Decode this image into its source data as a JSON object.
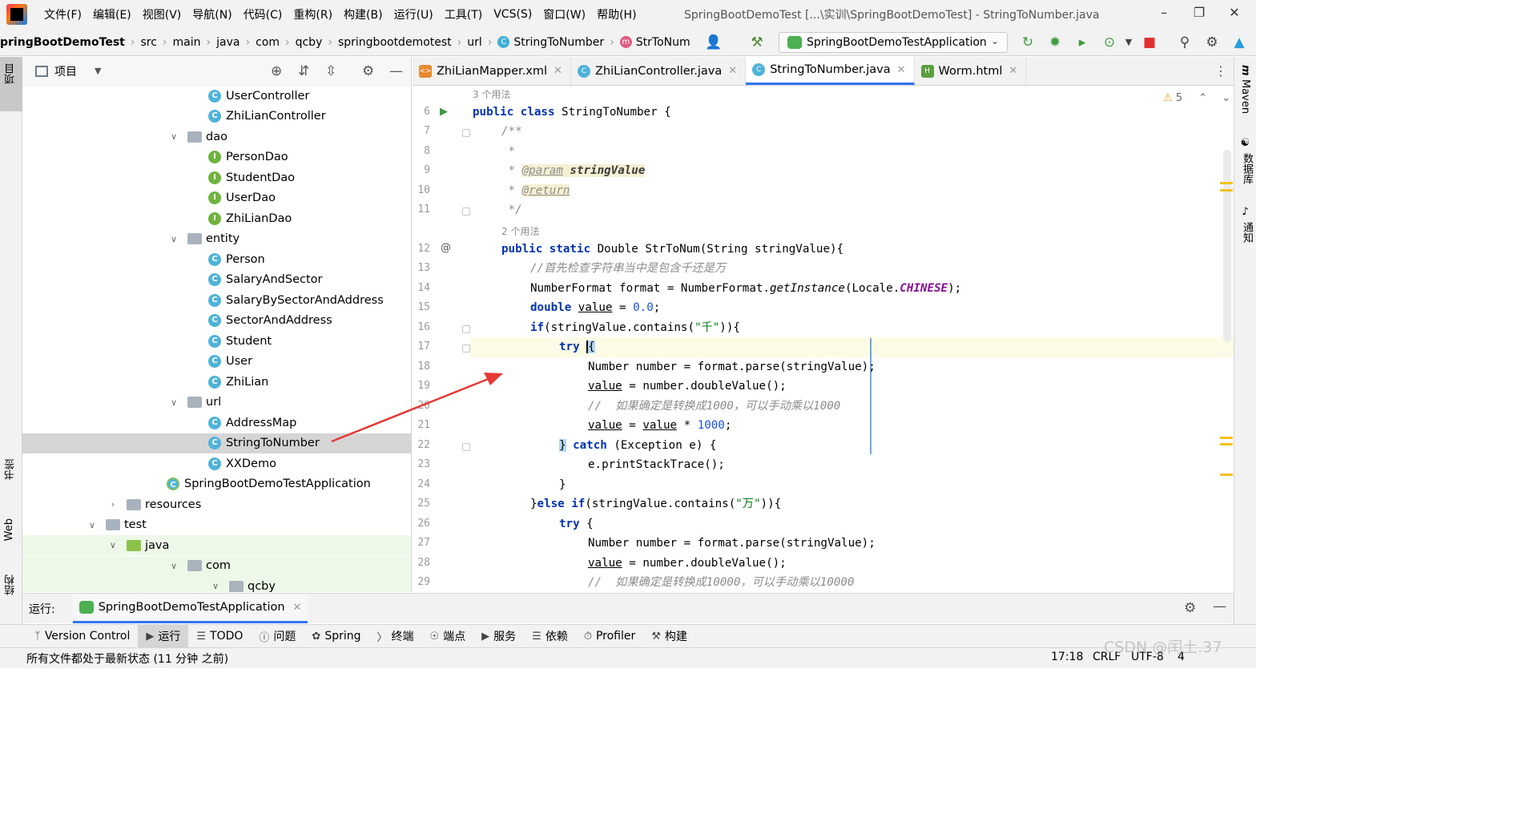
{
  "menu": [
    "文件(F)",
    "编辑(E)",
    "视图(V)",
    "导航(N)",
    "代码(C)",
    "重构(R)",
    "构建(B)",
    "运行(U)",
    "工具(T)",
    "VCS(S)",
    "窗口(W)",
    "帮助(H)"
  ],
  "window_title": "SpringBootDemoTest [...\\实训\\SpringBootDemoTest] - StringToNumber.java",
  "breadcrumbs": [
    "pringBootDemoTest",
    "src",
    "main",
    "java",
    "com",
    "qcby",
    "springbootdemotest",
    "url",
    "StringToNumber",
    "StrToNum"
  ],
  "run_config": "SpringBootDemoTestApplication",
  "left_strip": {
    "project": "项目",
    "bookmarks": "书签",
    "web": "Web",
    "structure": "结构"
  },
  "right_strip": {
    "maven": "Maven",
    "database": "数据库",
    "notifications": "通知"
  },
  "project_panel": {
    "title": "项目",
    "tree": [
      {
        "label": "UserController",
        "kind": "class",
        "level": 3
      },
      {
        "label": "ZhiLianController",
        "kind": "class",
        "level": 3
      },
      {
        "label": "dao",
        "kind": "folder",
        "level": 2,
        "expanded": true
      },
      {
        "label": "PersonDao",
        "kind": "interface",
        "level": 3
      },
      {
        "label": "StudentDao",
        "kind": "interface",
        "level": 3
      },
      {
        "label": "UserDao",
        "kind": "interface",
        "level": 3
      },
      {
        "label": "ZhiLianDao",
        "kind": "interface",
        "level": 3
      },
      {
        "label": "entity",
        "kind": "folder",
        "level": 2,
        "expanded": true
      },
      {
        "label": "Person",
        "kind": "class",
        "level": 3
      },
      {
        "label": "SalaryAndSector",
        "kind": "class",
        "level": 3
      },
      {
        "label": "SalaryBySectorAndAddress",
        "kind": "class",
        "level": 3
      },
      {
        "label": "SectorAndAddress",
        "kind": "class",
        "level": 3
      },
      {
        "label": "Student",
        "kind": "class",
        "level": 3
      },
      {
        "label": "User",
        "kind": "class",
        "level": 3
      },
      {
        "label": "ZhiLian",
        "kind": "class",
        "level": 3
      },
      {
        "label": "url",
        "kind": "folder",
        "level": 2,
        "expanded": true
      },
      {
        "label": "AddressMap",
        "kind": "class",
        "level": 3
      },
      {
        "label": "StringToNumber",
        "kind": "runclass",
        "level": 3,
        "selected": true
      },
      {
        "label": "XXDemo",
        "kind": "runclass",
        "level": 3
      },
      {
        "label": "SpringBootDemoTestApplication",
        "kind": "spring",
        "level": 2
      },
      {
        "label": "resources",
        "kind": "folder",
        "level": 1,
        "expanded": false
      },
      {
        "label": "test",
        "kind": "folder",
        "level": 0,
        "expanded": true
      },
      {
        "label": "java",
        "kind": "greenfolder",
        "level": 1,
        "expanded": true,
        "test": true
      },
      {
        "label": "com",
        "kind": "folder",
        "level": 2,
        "expanded": true,
        "test": true
      },
      {
        "label": "qcby",
        "kind": "folder",
        "level": 3,
        "expanded": true,
        "test": true
      }
    ]
  },
  "editor_tabs": [
    {
      "label": "ZhiLianMapper.xml",
      "icon": "xml"
    },
    {
      "label": "ZhiLianController.java",
      "icon": "java"
    },
    {
      "label": "StringToNumber.java",
      "icon": "java",
      "active": true
    },
    {
      "label": "Worm.html",
      "icon": "html"
    }
  ],
  "editor": {
    "warnings": "5",
    "usage_hint_class": "3 个用法",
    "usage_hint_method": "2 个用法",
    "line_numbers": [
      "6",
      "7",
      "8",
      "9",
      "10",
      "11",
      "12",
      "13",
      "14",
      "15",
      "16",
      "17",
      "18",
      "19",
      "20",
      "21",
      "22",
      "23",
      "24",
      "25",
      "26",
      "27",
      "28",
      "29"
    ],
    "code": {
      "l6_kw": "public class",
      "l6_rest": " StringToNumber {",
      "l7": "/**",
      "l8": " *",
      "l9_star": " * ",
      "l9_tag": "@param",
      "l9_param": "stringValue",
      "l10_star": " * ",
      "l10_tag": "@return",
      "l11": " */",
      "l12_kw": "public static",
      "l12_rest": " Double StrToNum(String stringValue){",
      "l13": "//首先检查字符串当中是包含千还是万",
      "l14_a": "NumberFormat format = NumberFormat.",
      "l14_m": "getInstance",
      "l14_b": "(Locale.",
      "l14_c": "CHINESE",
      "l14_d": ");",
      "l15_kw": "double",
      "l15_v": "value",
      "l15_eq": " = ",
      "l15_n": "0.0",
      "l15_end": ";",
      "l16_kw": "if",
      "l16_a": "(stringValue.contains(",
      "l16_s": "\"千\"",
      "l16_b": ")){",
      "l17_kw": "try",
      "l17_b": "{",
      "l18": "Number number = format.parse(stringValue);",
      "l19_v": "value",
      "l19_rest": " = number.doubleValue();",
      "l20": "//  如果确定是转换成1000，可以手动乘以1000",
      "l21_v": "value",
      "l21_eq": " = ",
      "l21_v2": "value",
      "l21_op": " * ",
      "l21_n": "1000",
      "l21_end": ";",
      "l22_b": "}",
      "l22_kw": " catch",
      "l22_rest": " (Exception e) {",
      "l23": "e.printStackTrace();",
      "l24": "}",
      "l25_a": "}",
      "l25_kw": "else if",
      "l25_b": "(stringValue.contains(",
      "l25_s": "\"万\"",
      "l25_c": ")){",
      "l26_kw": "try",
      "l26_b": " {",
      "l27": "Number number = format.parse(stringValue);",
      "l28_v": "value",
      "l28_rest": " = number.doubleValue();",
      "l29": "//  如果确定是转换成10000，可以手动乘以10000"
    }
  },
  "run_bar": {
    "label": "运行:",
    "tab": "SpringBootDemoTestApplication"
  },
  "tool_windows": [
    "Version Control",
    "运行",
    "TODO",
    "问题",
    "Spring",
    "终端",
    "端点",
    "服务",
    "依赖",
    "Profiler",
    "构建"
  ],
  "status": {
    "message": "所有文件都处于最新状态 (11 分钟 之前)",
    "position": "17:18",
    "line_sep": "CRLF",
    "encoding": "UTF-8",
    "indent": "4"
  },
  "watermark": "CSDN @闰土.37",
  "colors": {
    "accent": "#3574f0",
    "annotation_arrow": "#e53935",
    "keyword": "#0033b3",
    "string": "#067d17",
    "number": "#1750eb"
  }
}
